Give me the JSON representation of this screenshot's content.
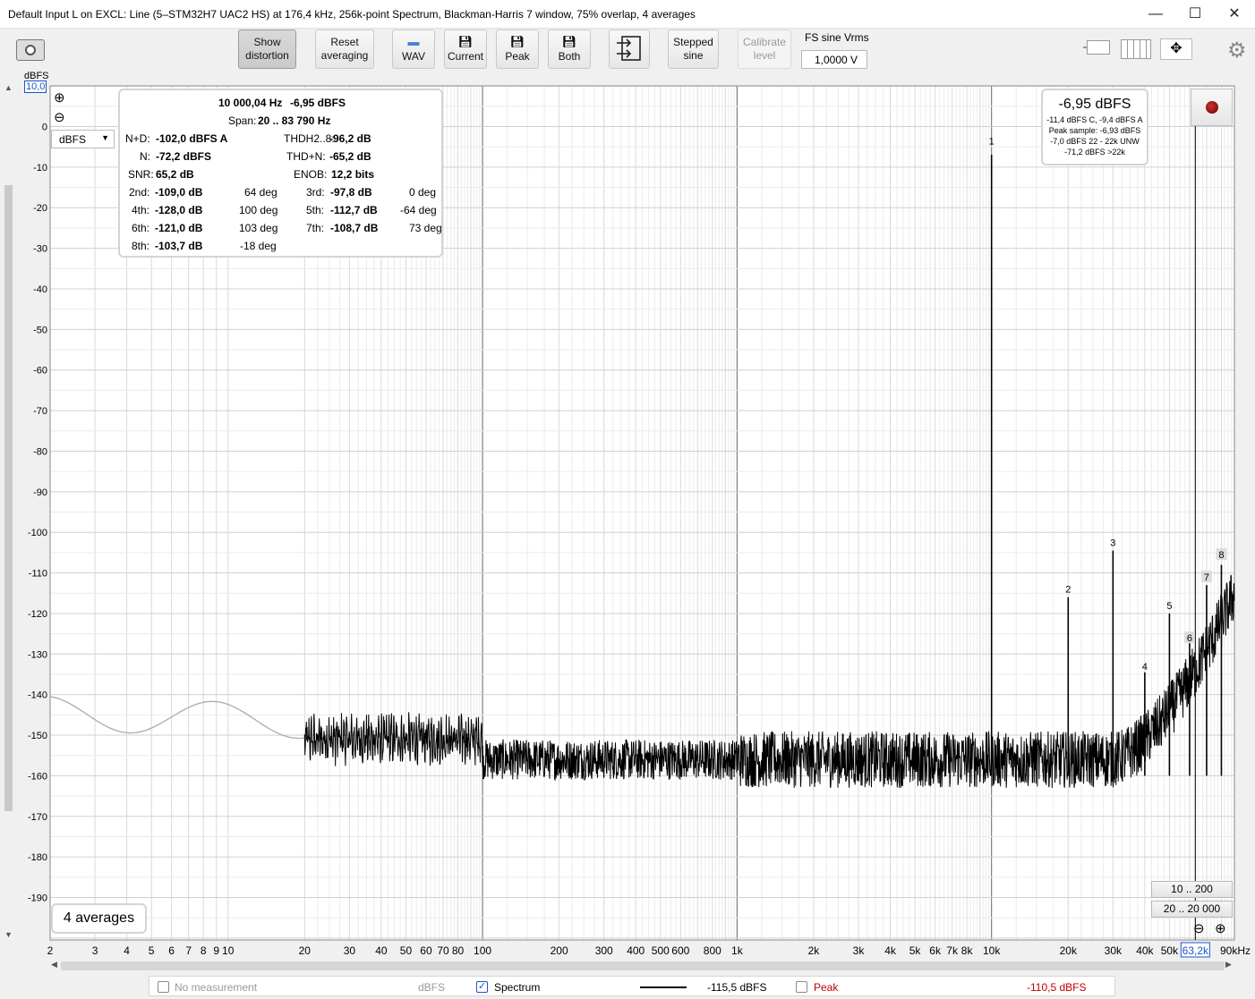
{
  "window": {
    "title": "Default Input L on EXCL: Line (5–STM32H7 UAC2 HS) at 176,4 kHz, 256k-point Spectrum, Blackman-Harris 7 window, 75% overlap, 4 averages",
    "minimize": "—",
    "maximize": "☐",
    "close": "✕"
  },
  "toolbar": {
    "show_distortion": [
      "Show",
      "distortion"
    ],
    "reset_averaging": [
      "Reset",
      "averaging"
    ],
    "wav": "WAV",
    "current": "Current",
    "peak": "Peak",
    "both": "Both",
    "stepped_sine": [
      "Stepped",
      "sine"
    ],
    "calibrate_level": [
      "Calibrate",
      "level"
    ],
    "fs_label": "FS sine Vrms",
    "fs_value": "1,0000 V"
  },
  "yaxis": {
    "unit": "dBFS",
    "top_value": "10,0",
    "unit_select": "dBFS",
    "ticks": [
      "0",
      "-10",
      "-20",
      "-30",
      "-40",
      "-50",
      "-60",
      "-70",
      "-80",
      "-90",
      "-100",
      "-110",
      "-120",
      "-130",
      "-140",
      "-150",
      "-160",
      "-170",
      "-180",
      "-190"
    ]
  },
  "xaxis": {
    "ticks": [
      "2",
      "3",
      "4",
      "5",
      "6",
      "7",
      "8",
      "9",
      "10",
      "20",
      "30",
      "40",
      "50",
      "60",
      "70",
      "80",
      "100",
      "200",
      "300",
      "400",
      "500",
      "600",
      "800",
      "1k",
      "2k",
      "3k",
      "4k",
      "5k",
      "6k",
      "7k",
      "8k",
      "10k",
      "20k",
      "30k",
      "40k",
      "50k",
      "63,2k",
      "90kHz"
    ]
  },
  "distortion": {
    "freq": "10 000,04 Hz",
    "level": "-6,95 dBFS",
    "span_label": "Span:",
    "span": "20 .. 83 790 Hz",
    "nd_label": "N+D:",
    "nd": "-102,0 dBFS A",
    "thd_label": "THDH2..8:",
    "thd": "-96,2 dB",
    "n_label": "N:",
    "n": "-72,2 dBFS",
    "thdn_label": "THD+N:",
    "thdn": "-65,2 dB",
    "snr_label": "SNR:",
    "snr": "65,2 dB",
    "enob_label": "ENOB:",
    "enob": "12,2 bits",
    "harmonics": [
      {
        "label": "2nd:",
        "value": "-109,0 dB",
        "phase": "64 deg"
      },
      {
        "label": "3rd:",
        "value": "-97,8 dB",
        "phase": "0 deg"
      },
      {
        "label": "4th:",
        "value": "-128,0 dB",
        "phase": "100 deg"
      },
      {
        "label": "5th:",
        "value": "-112,7 dB",
        "phase": "-64 deg"
      },
      {
        "label": "6th:",
        "value": "-121,0 dB",
        "phase": "103 deg"
      },
      {
        "label": "7th:",
        "value": "-108,7 dB",
        "phase": "73 deg"
      },
      {
        "label": "8th:",
        "value": "-103,7 dB",
        "phase": "-18 deg"
      }
    ]
  },
  "level_panel": {
    "main": "-6,95 dBFS",
    "l1": "-11,4 dBFS C, -9,4 dBFS A",
    "l2": "Peak sample: -6,93 dBFS",
    "l3": "-7,0 dBFS 22 - 22k UNW",
    "l4": "-71,2 dBFS >22k"
  },
  "markers": [
    "1",
    "2",
    "3",
    "4",
    "5",
    "6",
    "7",
    "8"
  ],
  "averages": "4 averages",
  "ranges": [
    "10 .. 200",
    "20 .. 20 000"
  ],
  "legend": {
    "no_measurement": "No measurement",
    "no_measurement_unit": "dBFS",
    "spectrum": "Spectrum",
    "spectrum_value": "-115,5 dBFS",
    "peak": "Peak",
    "peak_value": "-110,5 dBFS"
  },
  "colors": {
    "peak_red": "#c00000",
    "accent_blue": "#1a56c8",
    "trace_black": "#000000",
    "trace_grey": "#b0b0b0"
  }
}
